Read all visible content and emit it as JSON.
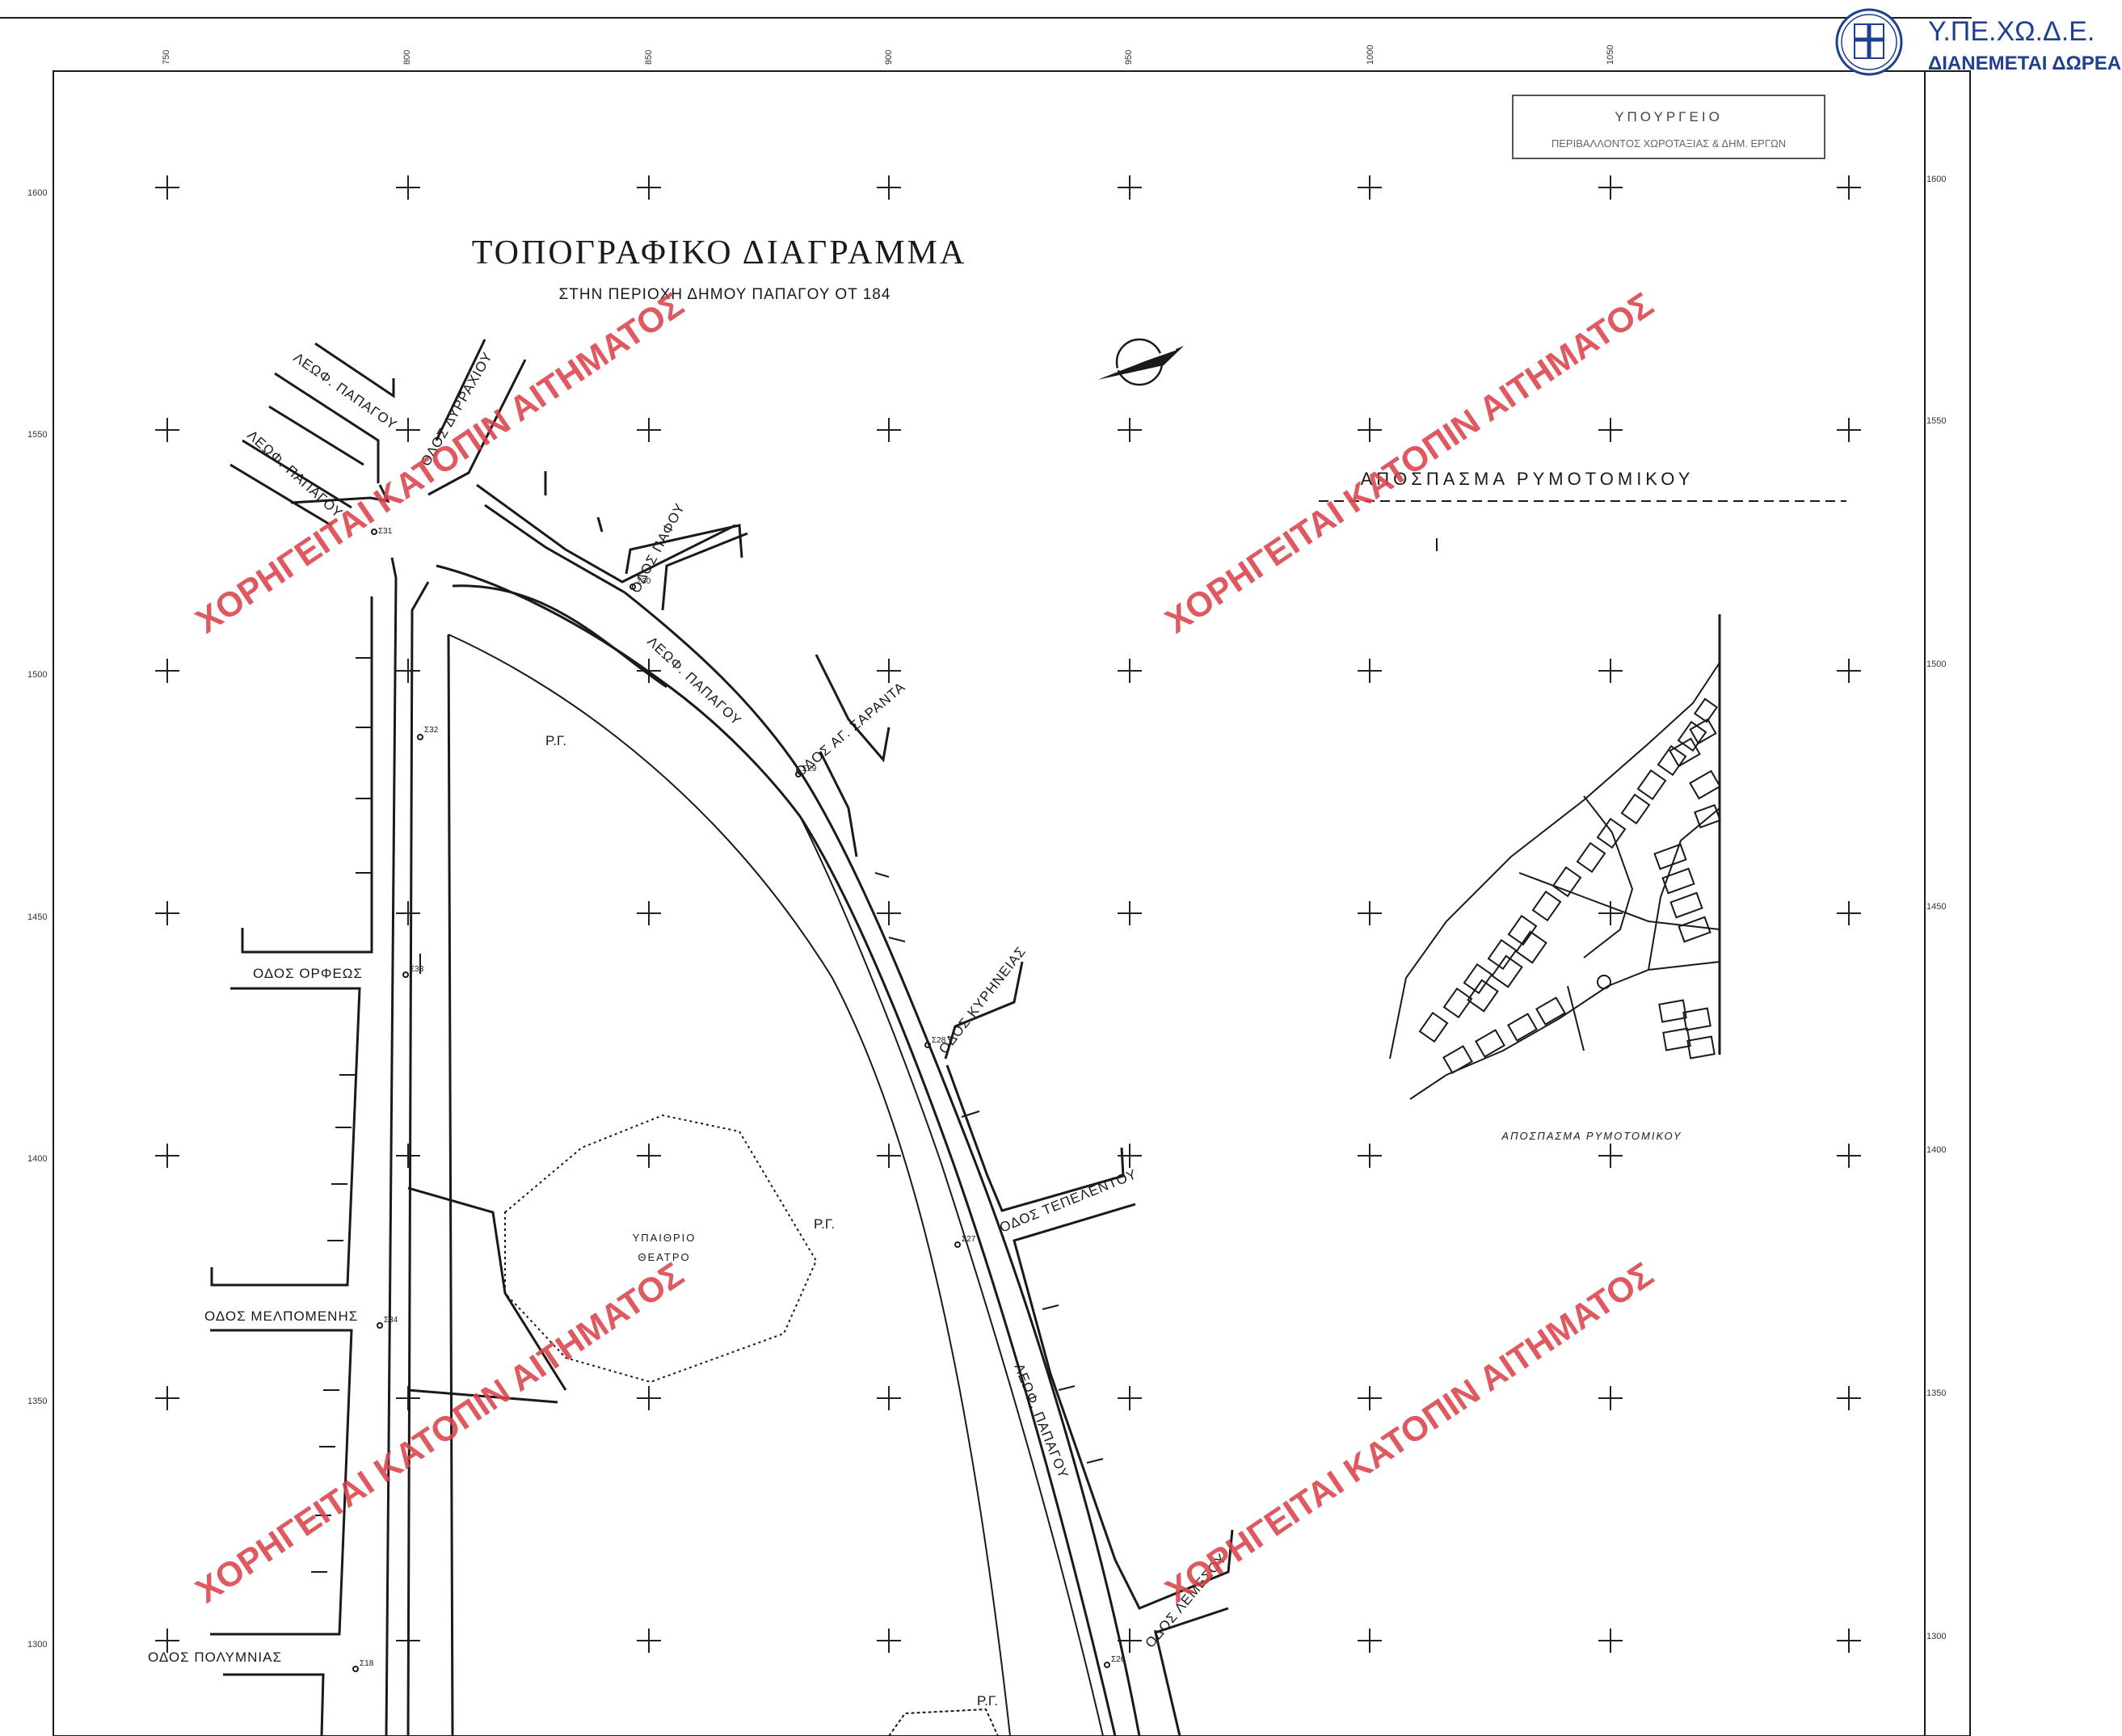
{
  "header": {
    "logo": "greek-state-emblem",
    "org": "Υ.ΠΕ.ΧΩ.Δ.Ε.",
    "notice": "ΔΙΑΝΕΜΕΤΑΙ ΔΩΡΕΑΝ"
  },
  "stamp": {
    "line1": "ΥΠΟΥΡΓΕΙΟ",
    "line2": "ΠΕΡΙΒΑΛΛΟΝΤΟΣ ΧΩΡΟΤΑΞΙΑΣ & ΔΗΜ. ΕΡΓΩΝ"
  },
  "title": {
    "main": "ΤΟΠΟΓΡΑΦΙΚΟ  ΔΙΑΓΡΑΜΜΑ",
    "sub": "ΣΤΗΝ ΠΕΡΙΟΧΗ ΔΗΜΟΥ ΠΑΠΑΓΟΥ ΟΤ 184"
  },
  "excerpt": {
    "title": "ΑΠΟΣΠΑΣΜΑ  ΡΥΜΟΤΟΜΙΚΟΥ",
    "caption": "ΑΠΟΣΠΑΣΜΑ ΡΥΜΟΤΟΜΙΚΟΥ"
  },
  "axes": {
    "top": [
      "750",
      "800",
      "850",
      "900",
      "950",
      "1000",
      "1050"
    ],
    "left": [
      "1600",
      "1550",
      "1500",
      "1450",
      "1400",
      "1350",
      "1300"
    ],
    "right": [
      "1600",
      "1550",
      "1500",
      "1450",
      "1400",
      "1350",
      "1300"
    ]
  },
  "streets": {
    "leof_papagou_1": "ΛΕΩΦ. ΠΑΠΑΓΟΥ",
    "leof_papagou_2": "ΛΕΩΦ. ΠΑΠΑΓΟΥ",
    "leof_papagou_3": "ΛΕΩΦ. ΠΑΠΑΓΟΥ",
    "leof_papagou_4": "ΛΕΩΦ. ΠΑΠΑΓΟΥ",
    "dyrrachiou": "ΟΔΟΣ ΔΥΡΡΑΧΙΟΥ",
    "pafou": "ΟΔΟΣ ΠΑΦΟΥ",
    "ag_saranta": "ΟΔΟΣ ΑΓ. ΣΑΡΑΝΤΑ",
    "kyrineias": "ΟΔΟΣ ΚΥΡΗΝΕΙΑΣ",
    "tepelentou": "ΟΔΟΣ ΤΕΠΕΛΕΝΤΟΥ",
    "lemesou": "ΟΔΟΣ ΛΕΜΕΣΟΥ",
    "orfeos": "ΟΔΟΣ ΟΡΦΕΩΣ",
    "melpomenis": "ΟΔΟΣ ΜΕΛΠΟΜΕΝΗΣ",
    "polymnias": "ΟΔΟΣ ΠΟΛΥΜΝΙΑΣ"
  },
  "labels": {
    "rg1": "Ρ.Γ.",
    "rg2": "Ρ.Γ.",
    "rg3": "Ρ.Γ.",
    "theater_line1": "ΥΠΑΙΘΡΙΟ",
    "theater_line2": "ΘΕΑΤΡΟ"
  },
  "points": {
    "s31": "Σ31",
    "s30": "Σ30",
    "s29": "Σ29",
    "s32": "Σ32",
    "s33": "Σ33",
    "s28": "Σ28",
    "s27": "Σ27",
    "s34": "Σ34",
    "s18": "Σ18",
    "s26": "Σ26"
  },
  "watermark": {
    "text1": "ΧΟΡΗΓΕΙΤΑΙ ΚΑΤΟΠΙΝ ΑΙΤΗΜΑΤΟΣ",
    "text2": "ΧΟΡΗΓΕΙΤΑΙ ΚΑΤΟΠΙΝ ΑΙΤΗΜΑΤΟΣ",
    "text3": "ΧΟΡΗΓΕΙΤΑΙ ΚΑΤΟΠΙΝ ΑΙΤΗΜΑΤΟΣ",
    "text4": "ΧΟΡΗΓΕΙΤΑΙ ΚΑΤΟΠΙΝ ΑΙΤΗΜΑΤΟΣ"
  },
  "colors": {
    "watermark": "#d9424a",
    "header_blue": "#1f3f8f",
    "ink": "#1a1a1a"
  }
}
